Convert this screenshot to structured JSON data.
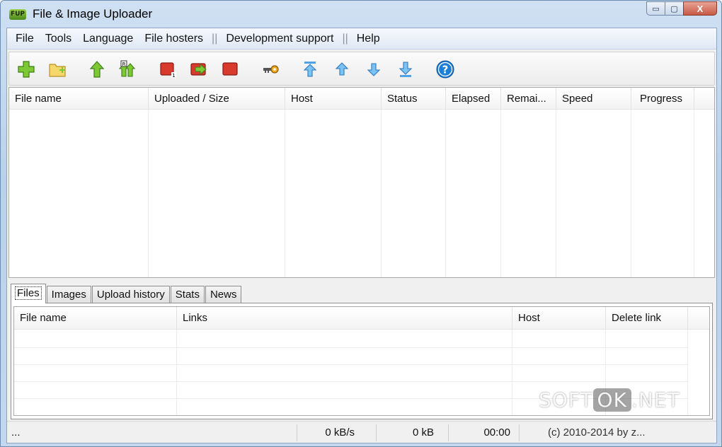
{
  "window": {
    "logo_text": "FUP",
    "title": "File & Image Uploader",
    "minimize": "▭",
    "maximize": "▢",
    "close": "X"
  },
  "menu": [
    "File",
    "Tools",
    "Language",
    "File hosters",
    "||",
    "Development support",
    "||",
    "Help"
  ],
  "toolbar": {
    "icons": [
      "add-file-icon",
      "add-folder-icon",
      "upload-icon",
      "reupload-icon",
      "stop-one-icon",
      "stop-next-icon",
      "stop-all-icon",
      "settings-key-icon",
      "move-top-icon",
      "move-up-icon",
      "move-down-icon",
      "move-bottom-icon",
      "help-icon"
    ],
    "help_glyph": "?"
  },
  "upload_list": {
    "columns": [
      "File name",
      "Uploaded / Size",
      "Host",
      "Status",
      "Elapsed",
      "Remai...",
      "Speed",
      "Progress"
    ]
  },
  "tabs": [
    "Files",
    "Images",
    "Upload history",
    "Stats",
    "News"
  ],
  "files_list": {
    "columns": [
      "File name",
      "Links",
      "Host",
      "Delete link"
    ]
  },
  "status": {
    "text": "...",
    "speed": "0 kB/s",
    "size": "0 kB",
    "time": "00:00",
    "copyright": "(c) 2010-2014 by z..."
  },
  "watermark": {
    "left": "SOFT",
    "middle": "OK",
    "right": ".NET"
  },
  "colors": {
    "title_bg": "#c3d7ee",
    "close_btn": "#c75a46",
    "green_icon": "#6cbf2a",
    "red_icon": "#d93a2e",
    "blue_icon": "#4fa2e6",
    "help_blue": "#1e7fd6"
  }
}
